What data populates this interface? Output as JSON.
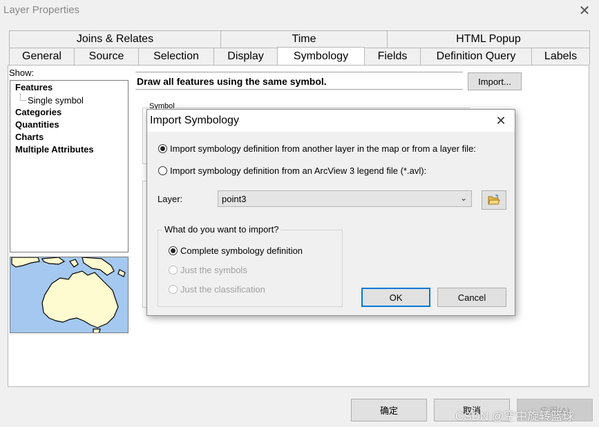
{
  "window": {
    "title": "Layer Properties",
    "close_glyph": "✕"
  },
  "tabs_top": [
    "Joins & Relates",
    "Time",
    "HTML Popup"
  ],
  "tabs_bottom": [
    "General",
    "Source",
    "Selection",
    "Display",
    "Symbology",
    "Fields",
    "Definition Query",
    "Labels"
  ],
  "active_tab": "Symbology",
  "show": {
    "label": "Show:",
    "items": [
      "Features",
      "Categories",
      "Quantities",
      "Charts",
      "Multiple Attributes"
    ],
    "sub_item": "Single symbol"
  },
  "symbology": {
    "description": "Draw all features using the same symbol.",
    "import_label": "Import...",
    "symbol_group_label": "Symbol"
  },
  "footer": {
    "ok_label": "确定",
    "cancel_label": "取消",
    "apply_label": "应用(A)"
  },
  "watermark": "CSDN @空中旋转篮球",
  "dialog": {
    "title": "Import Symbology",
    "close_glyph": "✕",
    "options": [
      "Import symbology definition from another layer in the map or from a layer file:",
      "Import symbology definition from an ArcView 3 legend file (*.avl):"
    ],
    "selected_option": 0,
    "layer_label": "Layer:",
    "layer_value": "point3",
    "folder_icon": "open-folder-icon",
    "group_label": "What do you want to import?",
    "import_options": [
      "Complete symbology definition",
      "Just the symbols",
      "Just the classification"
    ],
    "import_selected": 0,
    "ok_label": "OK",
    "cancel_label": "Cancel"
  },
  "colors": {
    "ocean": "#a4c8ef",
    "land": "#fffbd0",
    "accent": "#0078d7"
  }
}
